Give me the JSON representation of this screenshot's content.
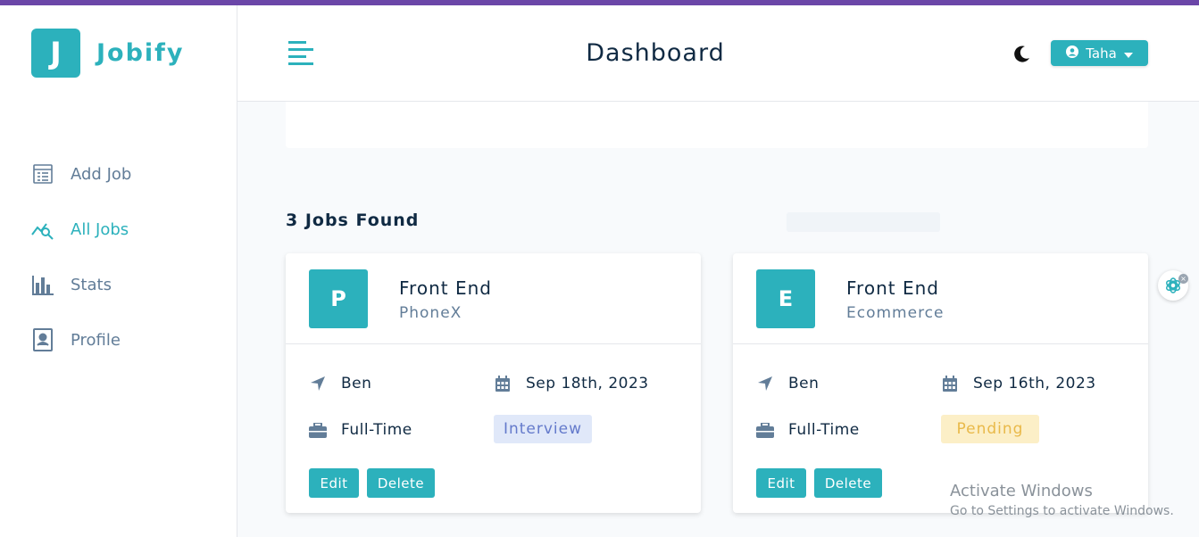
{
  "app": {
    "logo_letter": "J",
    "name": "Jobify",
    "accent_color": "#2cb1bc",
    "top_bar_color": "#6b46a8"
  },
  "sidebar": {
    "items": [
      {
        "label": "Add Job",
        "icon": "add-job-form-icon",
        "active": false
      },
      {
        "label": "All Jobs",
        "icon": "chart-search-icon",
        "active": true
      },
      {
        "label": "Stats",
        "icon": "bar-chart-icon",
        "active": false
      },
      {
        "label": "Profile",
        "icon": "id-card-icon",
        "active": false
      }
    ]
  },
  "header": {
    "title": "Dashboard",
    "theme_icon": "moon-icon",
    "user_name": "Taha"
  },
  "main": {
    "jobs_count_text": "3 Jobs Found",
    "jobs": [
      {
        "avatar_letter": "P",
        "position": "Front End",
        "company": "PhoneX",
        "location": "Ben",
        "date": "Sep 18th, 2023",
        "job_type": "Full-Time",
        "status": "Interview",
        "status_color": "#647acb",
        "edit_label": "Edit",
        "delete_label": "Delete"
      },
      {
        "avatar_letter": "E",
        "position": "Front End",
        "company": "Ecommerce",
        "location": "Ben",
        "date": "Sep 16th, 2023",
        "job_type": "Full-Time",
        "status": "Pending",
        "status_color": "#e9b949",
        "edit_label": "Edit",
        "delete_label": "Delete"
      }
    ]
  },
  "overlay": {
    "activate_title": "Activate Windows",
    "activate_subtitle": "Go to Settings to activate Windows."
  }
}
